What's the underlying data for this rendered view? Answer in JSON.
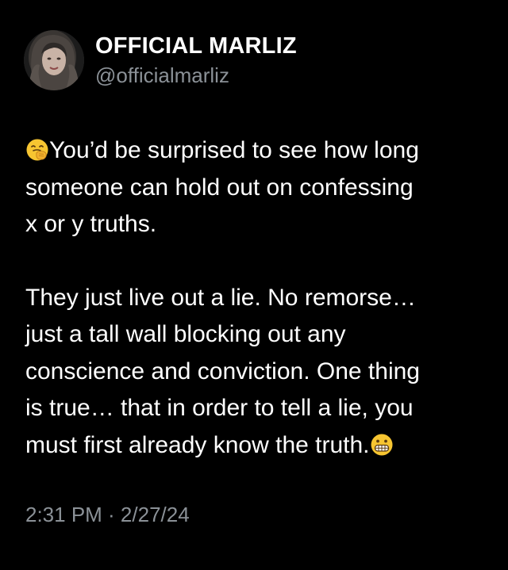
{
  "author": {
    "display_name": "OFFICIAL MARLIZ",
    "handle": "@officialmarliz",
    "avatar_icon": "profile-photo"
  },
  "post": {
    "paragraph1": {
      "leading_emoji": "face-with-hand-over-mouth-emoji",
      "lines": [
        "You’d be surprised to see how long",
        "someone can hold out on confessing",
        "x or y truths."
      ]
    },
    "paragraph2": {
      "lines": [
        "They just live out a lie. No remorse…",
        "just a tall wall blocking out any",
        "conscience and conviction. One thing",
        "is true… that in order to tell a lie, you",
        "must first already know the truth."
      ],
      "trailing_emoji": "grimacing-face-emoji"
    },
    "timestamp": "2:31 PM · 2/27/24"
  },
  "colors": {
    "background": "#000000",
    "text": "#ffffff",
    "secondary_text": "#8b9197",
    "emoji_yellow": "#f7c531"
  }
}
